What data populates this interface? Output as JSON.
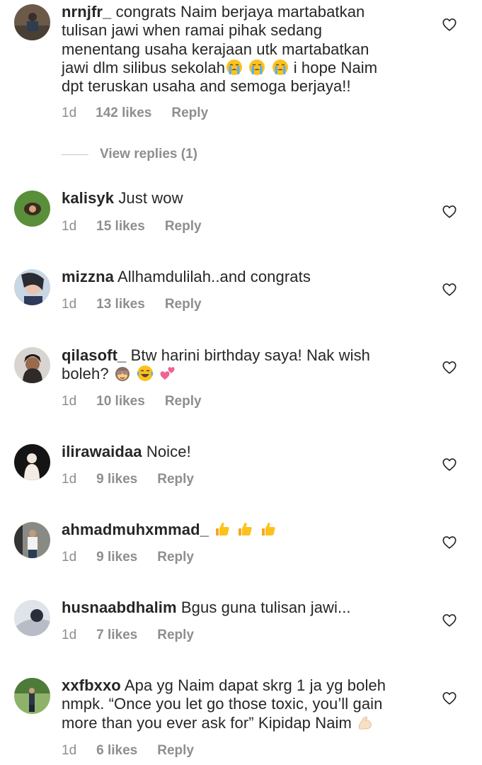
{
  "comments": [
    {
      "username": "nrnjfr_",
      "lines": [
        "congrats Naim berjaya martabatkan",
        "tulisan jawi when ramai pihak sedang",
        "menentang usaha kerajaan utk martabatkan",
        "jawi dlm silibus sekolah",
        "dpt teruskan usaha and semoga berjaya!!"
      ],
      "line4_tail": " i hope Naim",
      "emojis": [
        "loudly-crying-face",
        "loudly-crying-face",
        "loudly-crying-face"
      ],
      "time": "1d",
      "likes": "142 likes",
      "reply": "Reply",
      "view_replies": "View replies (1)"
    },
    {
      "username": "kalisyk",
      "text": "Just wow",
      "time": "1d",
      "likes": "15 likes",
      "reply": "Reply"
    },
    {
      "username": "mizzna",
      "text": "Allhamdulilah..and congrats",
      "time": "1d",
      "likes": "13 likes",
      "reply": "Reply"
    },
    {
      "username": "qilasoft_",
      "text": "Btw harini birthday saya! Nak wish",
      "line2": "boleh?",
      "emojis": [
        "see-no-evil-monkey",
        "tears-of-joy",
        "two-hearts"
      ],
      "time": "1d",
      "likes": "10 likes",
      "reply": "Reply"
    },
    {
      "username": "ilirawaidaa",
      "text": "Noice!",
      "time": "1d",
      "likes": "9 likes",
      "reply": "Reply"
    },
    {
      "username": "ahmadmuhxmmad_",
      "text": "",
      "emojis": [
        "thumbs-up",
        "thumbs-up",
        "thumbs-up"
      ],
      "time": "1d",
      "likes": "9 likes",
      "reply": "Reply"
    },
    {
      "username": "husnaabdhalim",
      "text": "Bgus guna tulisan jawi...",
      "time": "1d",
      "likes": "7 likes",
      "reply": "Reply"
    },
    {
      "username": "xxfbxxo",
      "lines": [
        "Apa yg Naim dapat skrg 1 ja yg boleh",
        "nmpk. “Once you let go those toxic, you’ll gain",
        "more than you ever ask for” Kipidap Naim"
      ],
      "emojis": [
        "flexed-biceps"
      ],
      "time": "1d",
      "likes": "6 likes",
      "reply": "Reply"
    }
  ],
  "icons": {
    "like": "heart-outline-icon"
  },
  "colors": {
    "text": "#262626",
    "muted": "#8e8e8e"
  }
}
